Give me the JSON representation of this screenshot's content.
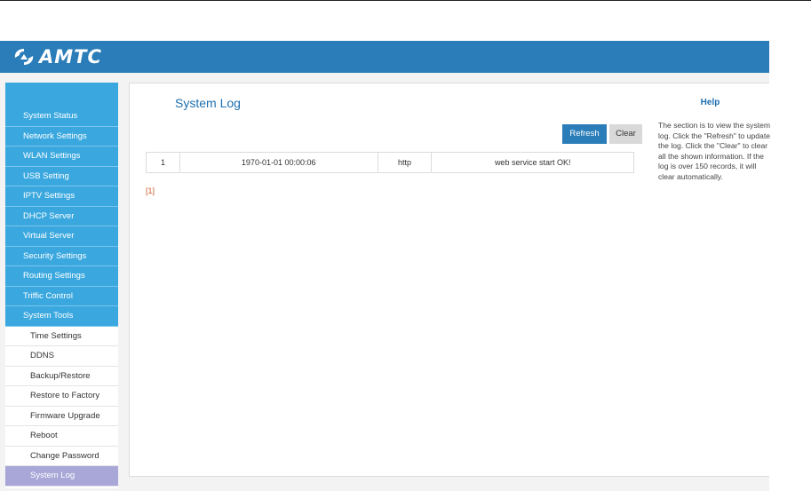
{
  "brand": {
    "name": "AMTC"
  },
  "sidebar": {
    "items": [
      {
        "label": "System Status"
      },
      {
        "label": "Network Settings"
      },
      {
        "label": "WLAN Settings"
      },
      {
        "label": "USB Setting"
      },
      {
        "label": "IPTV Settings"
      },
      {
        "label": "DHCP Server"
      },
      {
        "label": "Virtual Server"
      },
      {
        "label": "Security Settings"
      },
      {
        "label": "Routing Settings"
      },
      {
        "label": "Triffic Control"
      },
      {
        "label": "System Tools"
      }
    ],
    "sub_items": [
      {
        "label": "Time Settings"
      },
      {
        "label": "DDNS"
      },
      {
        "label": "Backup/Restore"
      },
      {
        "label": "Restore to Factory"
      },
      {
        "label": "Firmware Upgrade"
      },
      {
        "label": "Reboot"
      },
      {
        "label": "Change Password"
      },
      {
        "label": "System Log"
      }
    ],
    "active_sub_item": "System Log"
  },
  "main": {
    "title": "System Log",
    "refresh_label": "Refresh",
    "clear_label": "Clear",
    "log_rows": [
      {
        "index": "1",
        "time": "1970-01-01 00:00:06",
        "type": "http",
        "message": "web service start OK!"
      }
    ],
    "pager": "[1]"
  },
  "help": {
    "title": "Help",
    "text": "The section is to view the system log. Click the \"Refresh\" to update the log. Click the \"Clear\" to clear all the shown information. If the log is over 150 records, it will clear automatically."
  },
  "colors": {
    "header": "#2a7db8",
    "menu": "#3aa8df",
    "active_sub": "#a9a7d8",
    "title": "#1d6fb0"
  }
}
